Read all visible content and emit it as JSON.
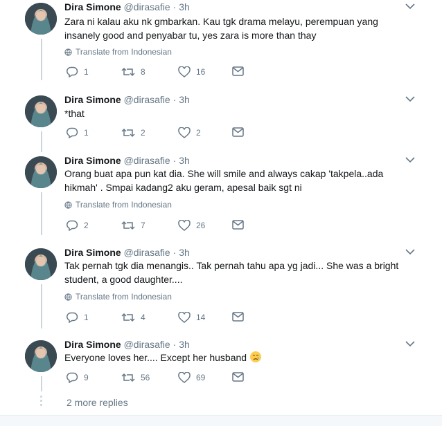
{
  "tweets": [
    {
      "name": "Dira Simone",
      "handle": "@dirasafie",
      "sep": "·",
      "time": "3h",
      "lines": [
        "Zara ni kalau aku nk gmbarkan. Kau tgk drama melayu, perempuan yang",
        "insanely good and penyabar tu, yes zara is more than thay"
      ],
      "translate": "Translate from Indonesian",
      "replies": "1",
      "retweets": "8",
      "likes": "16"
    },
    {
      "name": "Dira Simone",
      "handle": "@dirasafie",
      "sep": "·",
      "time": "3h",
      "lines": [
        "*that"
      ],
      "translate": "",
      "replies": "1",
      "retweets": "2",
      "likes": "2"
    },
    {
      "name": "Dira Simone",
      "handle": "@dirasafie",
      "sep": "·",
      "time": "3h",
      "lines": [
        "Orang buat apa pun kat dia. She will smile and always cakap 'takpela..ada",
        "hikmah' . Smpai kadang2 aku geram, apesal baik sgt ni"
      ],
      "translate": "Translate from Indonesian",
      "replies": "2",
      "retweets": "7",
      "likes": "26"
    },
    {
      "name": "Dira Simone",
      "handle": "@dirasafie",
      "sep": "·",
      "time": "3h",
      "lines": [
        "Tak pernah tgk dia menangis.. Tak pernah tahu apa yg jadi... She was a bright",
        "student, a good daughter...."
      ],
      "translate": "Translate from Indonesian",
      "replies": "1",
      "retweets": "4",
      "likes": "14"
    },
    {
      "name": "Dira Simone",
      "handle": "@dirasafie",
      "sep": "·",
      "time": "3h",
      "lines": [
        "Everyone loves her.... Except her husband"
      ],
      "translate": "",
      "replies": "9",
      "retweets": "56",
      "likes": "69"
    }
  ],
  "more_replies": "2 more replies",
  "colors": {
    "text": "#14171a",
    "muted": "#657786",
    "line": "#ccd6dd"
  },
  "icons": [
    "reply-icon",
    "retweet-icon",
    "like-icon",
    "dm-icon",
    "globe-icon",
    "chevron-down-icon",
    "crying-face-emoji"
  ]
}
